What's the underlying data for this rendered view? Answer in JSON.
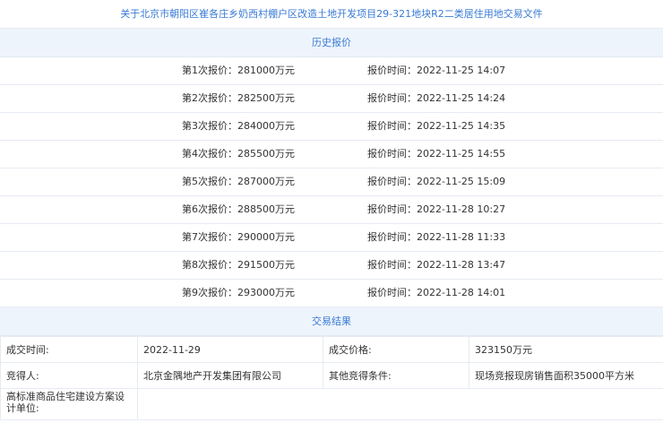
{
  "document_link": "关于北京市朝阳区崔各庄乡奶西村棚户区改造土地开发项目29-321地块R2二类居住用地交易文件",
  "history": {
    "title": "历史报价",
    "rows": [
      {
        "bid": "第1次报价：281000万元",
        "time": "报价时间：2022-11-25 14:07"
      },
      {
        "bid": "第2次报价：282500万元",
        "time": "报价时间：2022-11-25 14:24"
      },
      {
        "bid": "第3次报价：284000万元",
        "time": "报价时间：2022-11-25 14:35"
      },
      {
        "bid": "第4次报价：285500万元",
        "time": "报价时间：2022-11-25 14:55"
      },
      {
        "bid": "第5次报价：287000万元",
        "time": "报价时间：2022-11-25 15:09"
      },
      {
        "bid": "第6次报价：288500万元",
        "time": "报价时间：2022-11-28 10:27"
      },
      {
        "bid": "第7次报价：290000万元",
        "time": "报价时间：2022-11-28 11:33"
      },
      {
        "bid": "第8次报价：291500万元",
        "time": "报价时间：2022-11-28 13:47"
      },
      {
        "bid": "第9次报价：293000万元",
        "time": "报价时间：2022-11-28 14:01"
      }
    ]
  },
  "result": {
    "title": "交易结果",
    "deal_time_label": "成交时间:",
    "deal_time": "2022-11-29",
    "deal_price_label": "成交价格:",
    "deal_price": "323150万元",
    "winner_label": "竞得人:",
    "winner": "北京金隅地产开发集团有限公司",
    "other_terms_label": "其他竞得条件:",
    "other_terms": "现场竞报现房销售面积35000平方米",
    "design_unit_label": "高标准商品住宅建设方案设计单位:",
    "design_unit": ""
  }
}
